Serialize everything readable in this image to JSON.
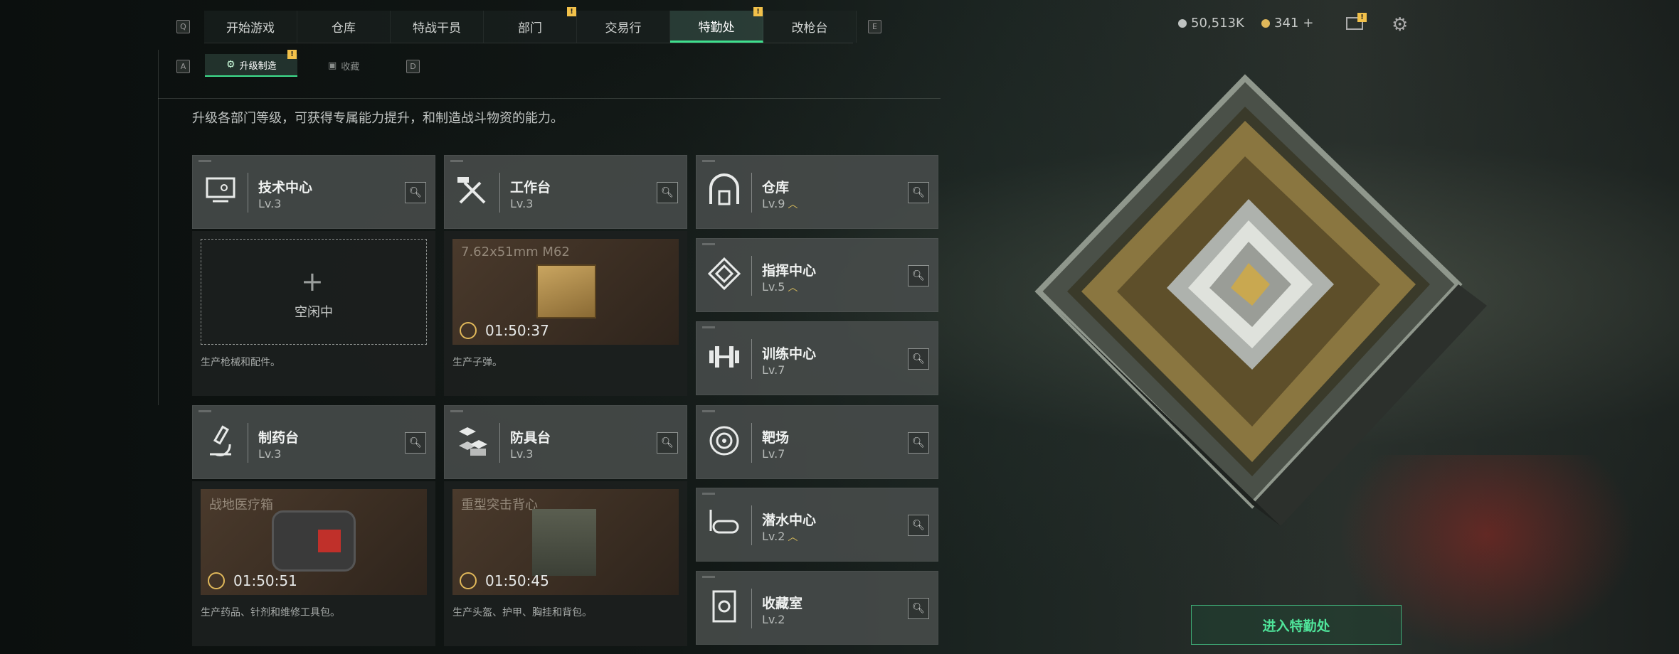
{
  "nav": {
    "left_key": "Q",
    "right_key": "E",
    "tabs": [
      {
        "label": "开始游戏",
        "badge": ""
      },
      {
        "label": "仓库",
        "badge": ""
      },
      {
        "label": "特战干员",
        "badge": ""
      },
      {
        "label": "部门",
        "badge": "!"
      },
      {
        "label": "交易行",
        "badge": ""
      },
      {
        "label": "特勤处",
        "badge": "!",
        "active": true
      },
      {
        "label": "改枪台",
        "badge": ""
      }
    ]
  },
  "subnav": {
    "left_key": "A",
    "right_key": "D",
    "tabs": [
      {
        "label": "升级制造",
        "badge": "!",
        "active": true
      },
      {
        "label": "收藏",
        "badge": ""
      }
    ]
  },
  "resources": {
    "currency": "50,513K",
    "coins": "341",
    "coins_add": "+",
    "mail_badge": "!"
  },
  "description": "升级各部门等级，可获得专属能力提升，和制造战斗物资的能力。",
  "production": [
    {
      "name": "技术中心",
      "level": "Lv.3",
      "icon": "monitor-icon",
      "state": "idle",
      "idle_label": "空闲中",
      "desc": "生产枪械和配件。"
    },
    {
      "name": "工作台",
      "level": "Lv.3",
      "icon": "tools-icon",
      "state": "busy",
      "item": "7.62x51mm M62",
      "timer": "01:50:37",
      "desc": "生产子弹。"
    },
    {
      "name": "制药台",
      "level": "Lv.3",
      "icon": "microscope-icon",
      "state": "busy",
      "item": "战地医疗箱",
      "timer": "01:50:51",
      "desc": "生产药品、针剂和维修工具包。"
    },
    {
      "name": "防具台",
      "level": "Lv.3",
      "icon": "cubes-icon",
      "state": "busy",
      "item": "重型突击背心",
      "timer": "01:50:45",
      "desc": "生产头盔、护甲、胸挂和背包。"
    }
  ],
  "facilities": [
    {
      "name": "仓库",
      "level": "Lv.9",
      "upgradable": true,
      "icon": "warehouse-icon"
    },
    {
      "name": "指挥中心",
      "level": "Lv.5",
      "upgradable": true,
      "icon": "diamond-icon"
    },
    {
      "name": "训练中心",
      "level": "Lv.7",
      "upgradable": false,
      "icon": "dumbbell-icon"
    },
    {
      "name": "靶场",
      "level": "Lv.7",
      "upgradable": false,
      "icon": "target-icon"
    },
    {
      "name": "潜水中心",
      "level": "Lv.2",
      "upgradable": true,
      "icon": "goggles-icon"
    },
    {
      "name": "收藏室",
      "level": "Lv.2",
      "upgradable": false,
      "icon": "vault-icon"
    }
  ],
  "upgrade_glyph": "︿",
  "enter_button": "进入特勤处",
  "colors": {
    "accent": "#3fe08e",
    "badge": "#f2c14a",
    "timer_ring": "#e0b85a"
  }
}
